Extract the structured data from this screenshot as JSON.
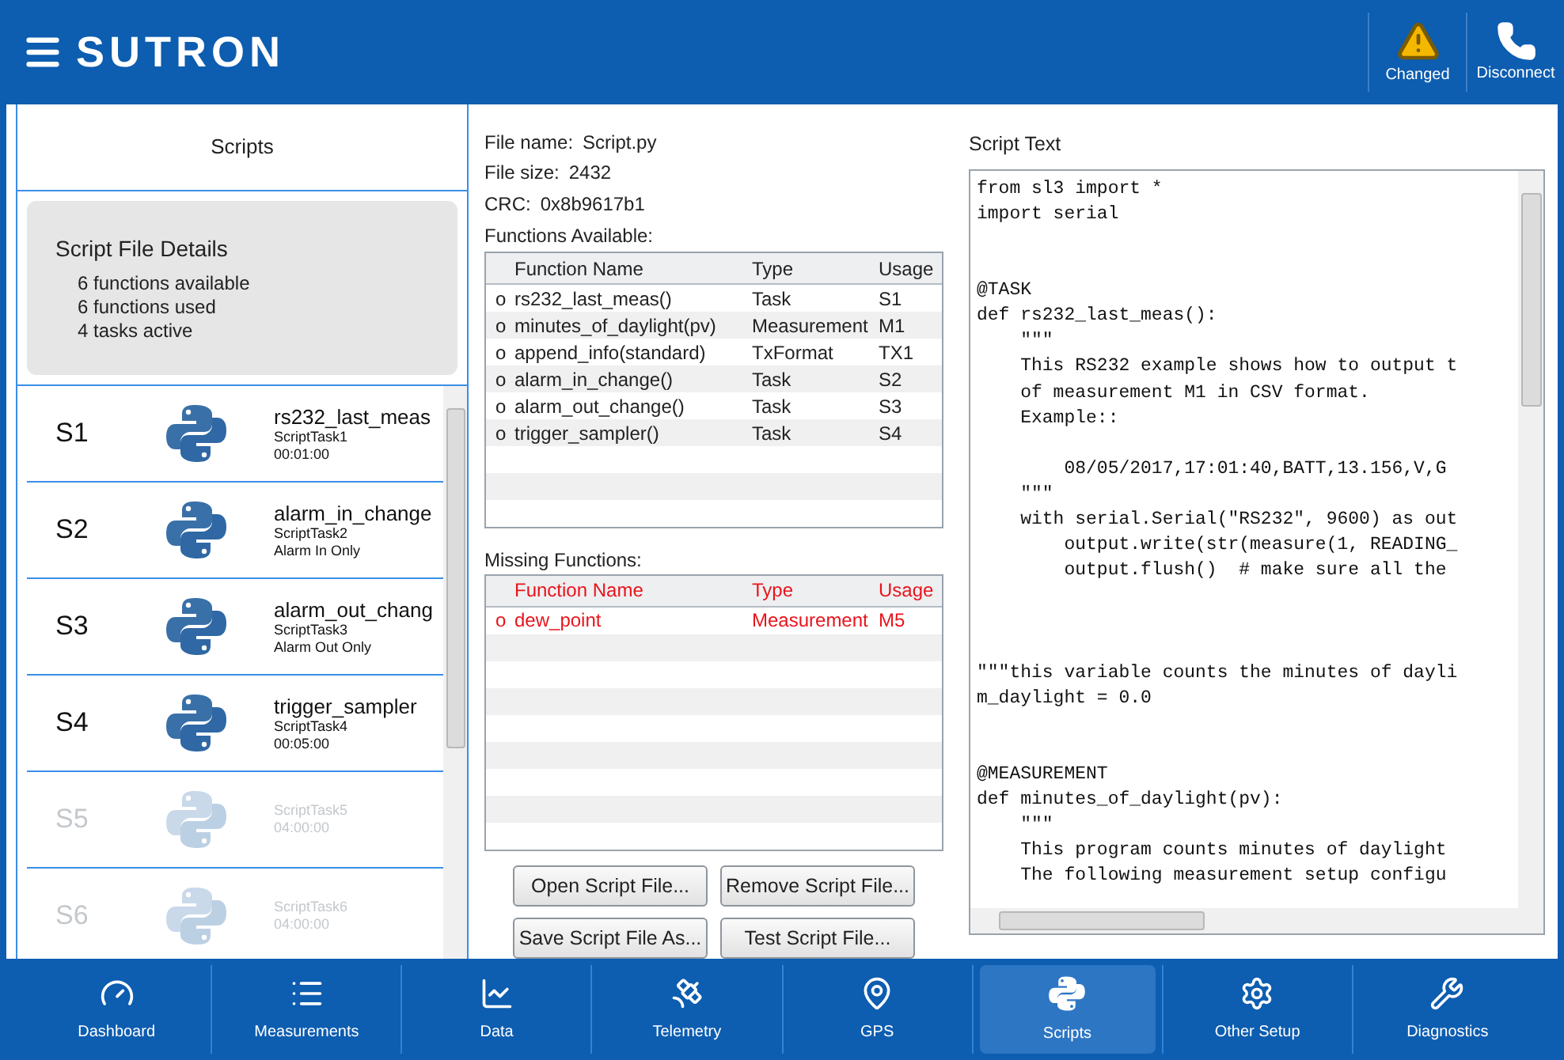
{
  "header": {
    "logo": "SUTRON",
    "actions": [
      {
        "kind": "warning",
        "label": "Changed"
      },
      {
        "kind": "phone",
        "label": "Disconnect"
      }
    ]
  },
  "sidebar": {
    "title": "Scripts",
    "details": {
      "title": "Script File Details",
      "lines": [
        "6 functions available",
        "6 functions used",
        "4 tasks active"
      ]
    },
    "items": [
      {
        "slot": "S1",
        "name": "rs232_last_meas",
        "task": "ScriptTask1",
        "detail": "00:01:00",
        "active": true
      },
      {
        "slot": "S2",
        "name": "alarm_in_change",
        "task": "ScriptTask2",
        "detail": "Alarm In Only",
        "active": true
      },
      {
        "slot": "S3",
        "name": "alarm_out_chang",
        "task": "ScriptTask3",
        "detail": "Alarm Out Only",
        "active": true
      },
      {
        "slot": "S4",
        "name": "trigger_sampler",
        "task": "ScriptTask4",
        "detail": "00:05:00",
        "active": true
      },
      {
        "slot": "S5",
        "task": "ScriptTask5",
        "detail": "04:00:00",
        "active": false
      },
      {
        "slot": "S6",
        "task": "ScriptTask6",
        "detail": "04:00:00",
        "active": false
      }
    ]
  },
  "file_info": [
    {
      "label": "File name:",
      "value": "Script.py"
    },
    {
      "label": "File size:",
      "value": "2432"
    },
    {
      "label": "CRC:",
      "value": "0x8b9617b1"
    }
  ],
  "functions_available": {
    "title": "Functions Available:",
    "columns": [
      "Function Name",
      "Type",
      "Usage"
    ],
    "rows": [
      {
        "marker": "o",
        "name": "rs232_last_meas()",
        "type": "Task",
        "usage": "S1"
      },
      {
        "marker": "o",
        "name": "minutes_of_daylight(pv)",
        "type": "Measurement",
        "usage": "M1"
      },
      {
        "marker": "o",
        "name": "append_info(standard)",
        "type": "TxFormat",
        "usage": "TX1"
      },
      {
        "marker": "o",
        "name": "alarm_in_change()",
        "type": "Task",
        "usage": "S2"
      },
      {
        "marker": "o",
        "name": "alarm_out_change()",
        "type": "Task",
        "usage": "S3"
      },
      {
        "marker": "o",
        "name": "trigger_sampler()",
        "type": "Task",
        "usage": "S4"
      }
    ]
  },
  "missing_functions": {
    "title": "Missing Functions:",
    "columns": [
      "Function Name",
      "Type",
      "Usage"
    ],
    "rows": [
      {
        "marker": "o",
        "name": "dew_point",
        "type": "Measurement",
        "usage": "M5"
      }
    ]
  },
  "buttons": [
    "Open Script File...",
    "Remove Script File...",
    "Save Script File As...",
    "Test Script File..."
  ],
  "script_text": {
    "title": "Script Text",
    "lines": [
      {
        "kind": "code",
        "text": "from sl3 import *"
      },
      {
        "kind": "code",
        "text": "import serial"
      },
      {
        "kind": "blank"
      },
      {
        "kind": "blank"
      },
      {
        "kind": "code",
        "text": "@TASK"
      },
      {
        "kind": "code",
        "text": "def rs232_last_meas():"
      },
      {
        "kind": "code",
        "text": "    \"\"\""
      },
      {
        "kind": "code",
        "text": "    This RS232 example shows how to output t"
      },
      {
        "kind": "code",
        "text": "    of measurement M1 in CSV format."
      },
      {
        "kind": "code",
        "text": "    Example::"
      },
      {
        "kind": "blank"
      },
      {
        "kind": "code",
        "text": "        08/05/2017,17:01:40,BATT,13.156,V,G"
      },
      {
        "kind": "code",
        "text": "    \"\"\""
      },
      {
        "kind": "code",
        "text": "    with serial.Serial(\"RS232\", 9600) as out"
      },
      {
        "kind": "code",
        "text": "        output.write(str(measure(1, READING_"
      },
      {
        "kind": "code",
        "text": "        output.flush()  # make sure all the"
      },
      {
        "kind": "blank"
      },
      {
        "kind": "blank"
      },
      {
        "kind": "blank"
      },
      {
        "kind": "code",
        "text": "\"\"\"this variable counts the minutes of dayli"
      },
      {
        "kind": "code",
        "text": "m_daylight = 0.0"
      },
      {
        "kind": "blank"
      },
      {
        "kind": "blank"
      },
      {
        "kind": "code",
        "text": "@MEASUREMENT"
      },
      {
        "kind": "code",
        "text": "def minutes_of_daylight(pv):"
      },
      {
        "kind": "code",
        "text": "    \"\"\""
      },
      {
        "kind": "code",
        "text": "    This program counts minutes of daylight"
      },
      {
        "kind": "code",
        "text": "    The following measurement setup configu"
      }
    ]
  },
  "nav": [
    {
      "kind": "dashboard",
      "label": "Dashboard",
      "selected": false
    },
    {
      "kind": "list",
      "label": "Measurements",
      "selected": false
    },
    {
      "kind": "chart",
      "label": "Data",
      "selected": false
    },
    {
      "kind": "dish",
      "label": "Telemetry",
      "selected": false
    },
    {
      "kind": "pin",
      "label": "GPS",
      "selected": false
    },
    {
      "kind": "python",
      "label": "Scripts",
      "selected": true
    },
    {
      "kind": "gear",
      "label": "Other Setup",
      "selected": false
    },
    {
      "kind": "wrench",
      "label": "Diagnostics",
      "selected": false
    }
  ]
}
